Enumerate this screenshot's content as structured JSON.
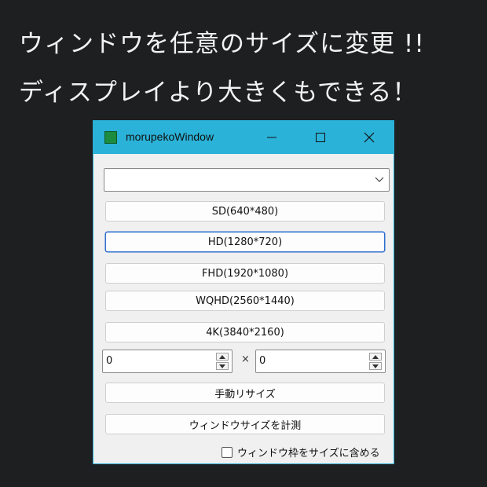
{
  "promo": {
    "line1": "ウィンドウを任意のサイズに変更 !!",
    "line2": "ディスプレイより大きくもできる！"
  },
  "window": {
    "title": "morupekoWindow",
    "titlebar_color": "#2ab2d8",
    "combo_value": ""
  },
  "presets": {
    "sd": "SD(640*480)",
    "hd": "HD(1280*720)",
    "fhd": "FHD(1920*1080)",
    "wqhd": "WQHD(2560*1440)",
    "k4": "4K(3840*2160)"
  },
  "custom": {
    "width_value": "0",
    "separator": "×",
    "height_value": "0"
  },
  "actions": {
    "manual_resize": "手動リサイズ",
    "measure": "ウィンドウサイズを計測"
  },
  "options": {
    "include_frame_label": "ウィンドウ枠をサイズに含める",
    "include_frame_checked": false
  }
}
